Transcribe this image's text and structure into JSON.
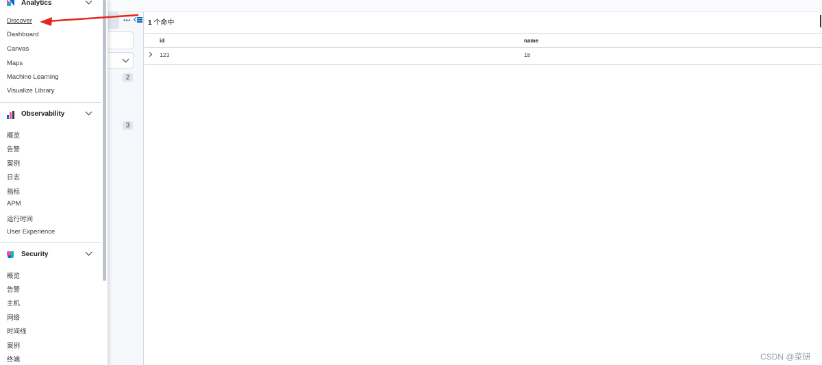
{
  "nav": {
    "groups": [
      {
        "label": "Analytics",
        "items": [
          "Discover",
          "Dashboard",
          "Canvas",
          "Maps",
          "Machine Learning",
          "Visualize Library"
        ]
      },
      {
        "label": "Observability",
        "items": [
          "概览",
          "告警",
          "案例",
          "日志",
          "指标",
          "APM",
          "运行时间",
          "User Experience"
        ]
      },
      {
        "label": "Security",
        "items": [
          "概览",
          "告警",
          "主机",
          "网络",
          "时间线",
          "案例",
          "终端"
        ]
      }
    ]
  },
  "sidebar_counts": [
    "2",
    "3"
  ],
  "toolbar": {
    "more_icon": "•••"
  },
  "results": {
    "hit_count": "1",
    "hit_label": "个命中",
    "columns": [
      "id",
      "name"
    ],
    "rows": [
      {
        "id": "123",
        "name": "1b"
      }
    ]
  },
  "watermark": "CSDN @菜研",
  "annotation_color": "#e8251d"
}
